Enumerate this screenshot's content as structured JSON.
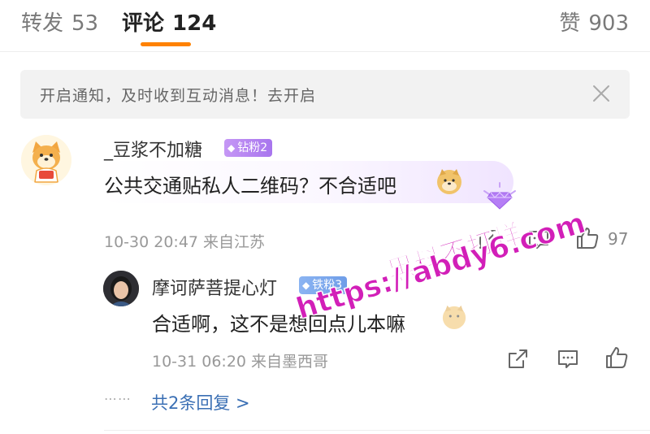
{
  "tabs": {
    "reposts": {
      "label": "转发",
      "count": "53"
    },
    "comments": {
      "label": "评论",
      "count": "124"
    },
    "likes": {
      "label": "赞",
      "count": "903"
    }
  },
  "notice": {
    "text": "开启通知，及时收到互动消息！去开启"
  },
  "comment": {
    "user": "_豆浆不加糖",
    "badge": "钻粉2",
    "text": "公共交通贴私人二维码？不合适吧",
    "meta": "10-30 20:47 来自江苏",
    "likes": "97"
  },
  "reply": {
    "user": "摩诃萨菩提心灯",
    "badge": "铁粉3",
    "text": "合适啊，这不是想回点儿本嘛",
    "meta": "10-31 06:20 来自墨西哥"
  },
  "more": {
    "dots": "⋯⋯",
    "label": "共2条回复 >"
  },
  "watermark": {
    "line1": "黑料不打烊",
    "line2": "https://abdy6.com"
  },
  "colors": {
    "accent": "#ff8200",
    "link": "#3a6fb4",
    "badge_diamond": "#b07ff0",
    "badge_iron": "#7aa5ec",
    "watermark": "#d21fb8"
  },
  "icons": {
    "share": "share-icon",
    "comment": "comment-icon",
    "like": "thumbs-up-icon",
    "close": "close-icon"
  }
}
